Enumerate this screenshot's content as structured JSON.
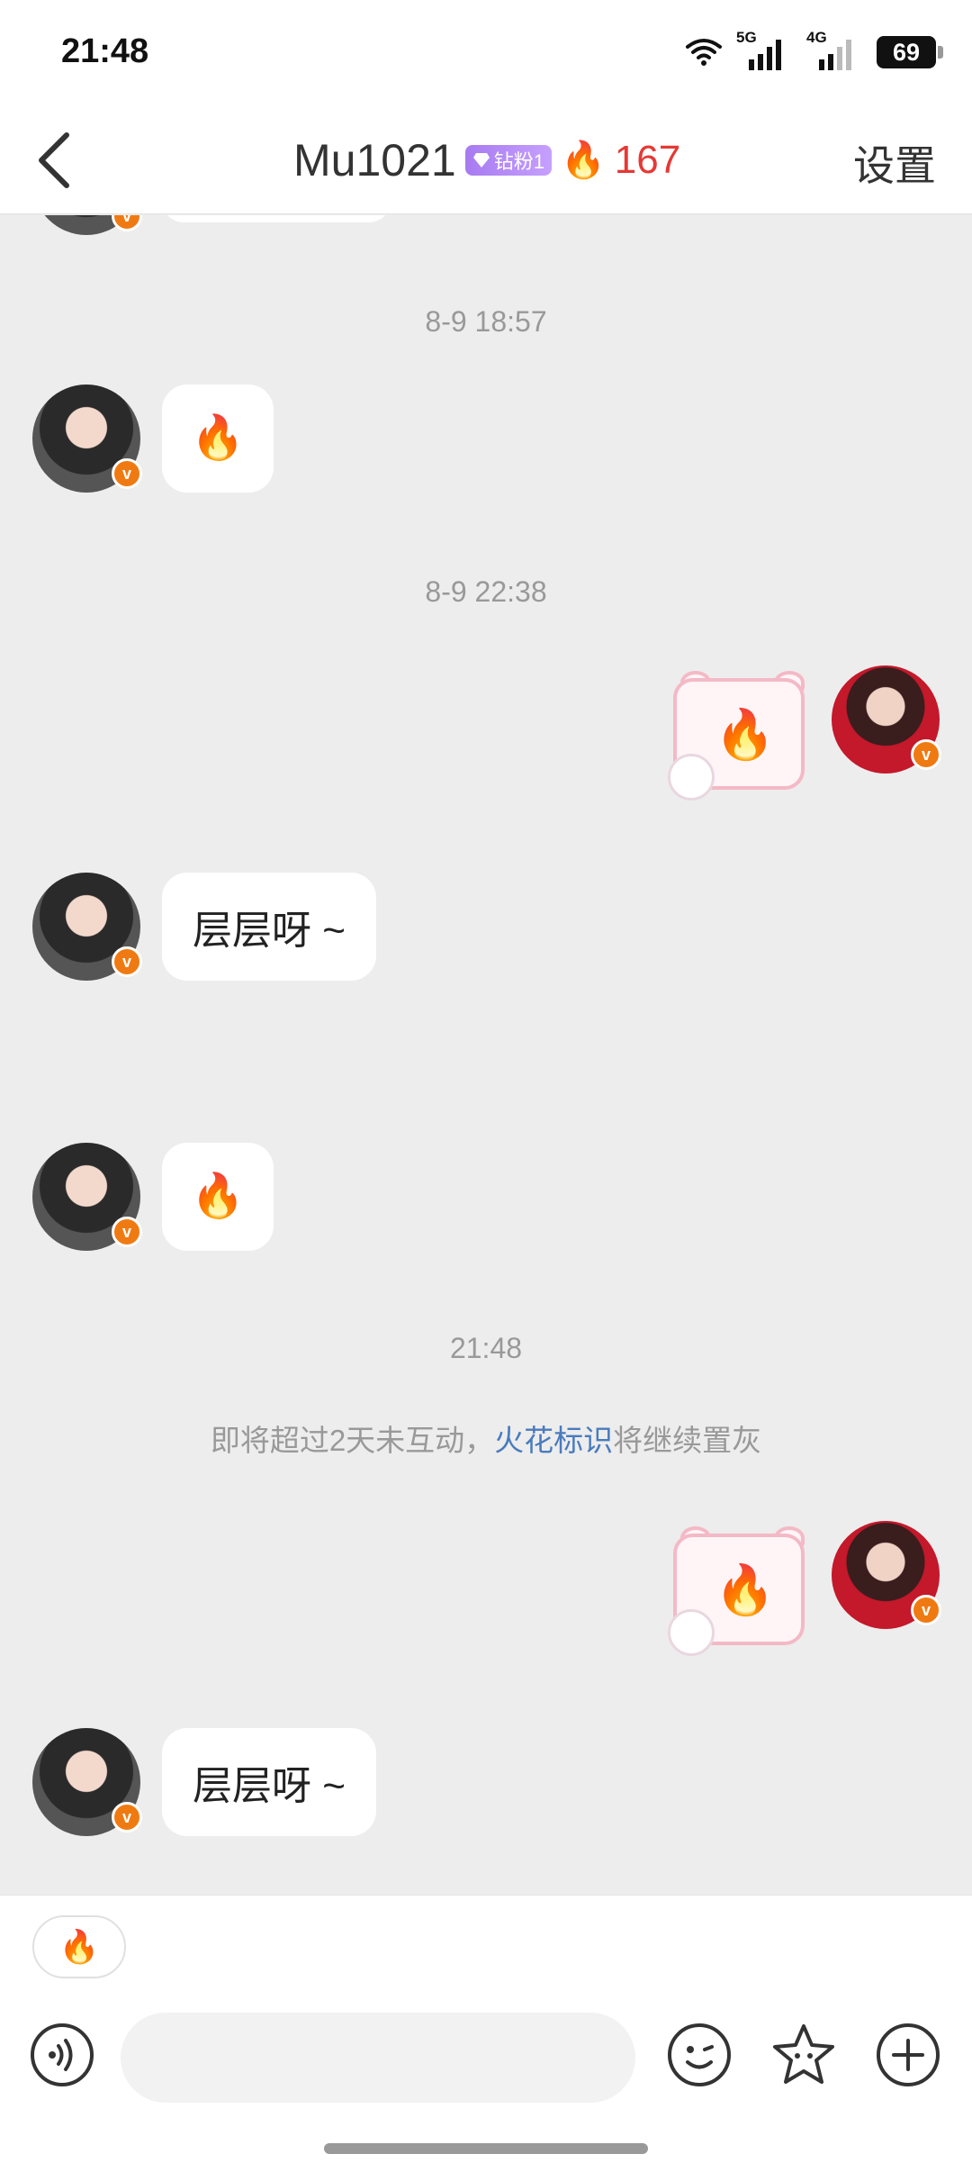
{
  "status_bar": {
    "time": "21:48",
    "network_a": "5G",
    "network_b": "4G",
    "battery": "69",
    "icons": [
      "wifi-icon",
      "signal-5g-icon",
      "signal-4g-icon",
      "battery-icon"
    ]
  },
  "header": {
    "title": "Mu1021",
    "fan_badge": "钻粉1",
    "streak_count": "167",
    "settings_label": "设置"
  },
  "messages": {
    "timestamp_1": "8-9 18:57",
    "msg_1_fire": "🔥",
    "timestamp_2": "8-9 22:38",
    "msg_2_sticker_fire": "🔥",
    "msg_3_text": "层层呀 ~",
    "msg_4_fire": "🔥",
    "timestamp_3": "21:48",
    "system_note_prefix": "即将超过2天未互动，",
    "system_note_link": "火花标识",
    "system_note_suffix": "将继续置灰",
    "msg_5_sticker_fire": "🔥",
    "msg_6_text": "层层呀 ~"
  },
  "composer": {
    "quick_reply": "🔥",
    "input_placeholder": "",
    "icons": [
      "voice-icon",
      "emoji-icon",
      "sticker-icon",
      "plus-icon"
    ]
  },
  "colors": {
    "streak_red": "#e53935",
    "verified_orange": "#f07a12",
    "link_blue": "#4a7bbd",
    "chat_bg": "#ededed"
  }
}
